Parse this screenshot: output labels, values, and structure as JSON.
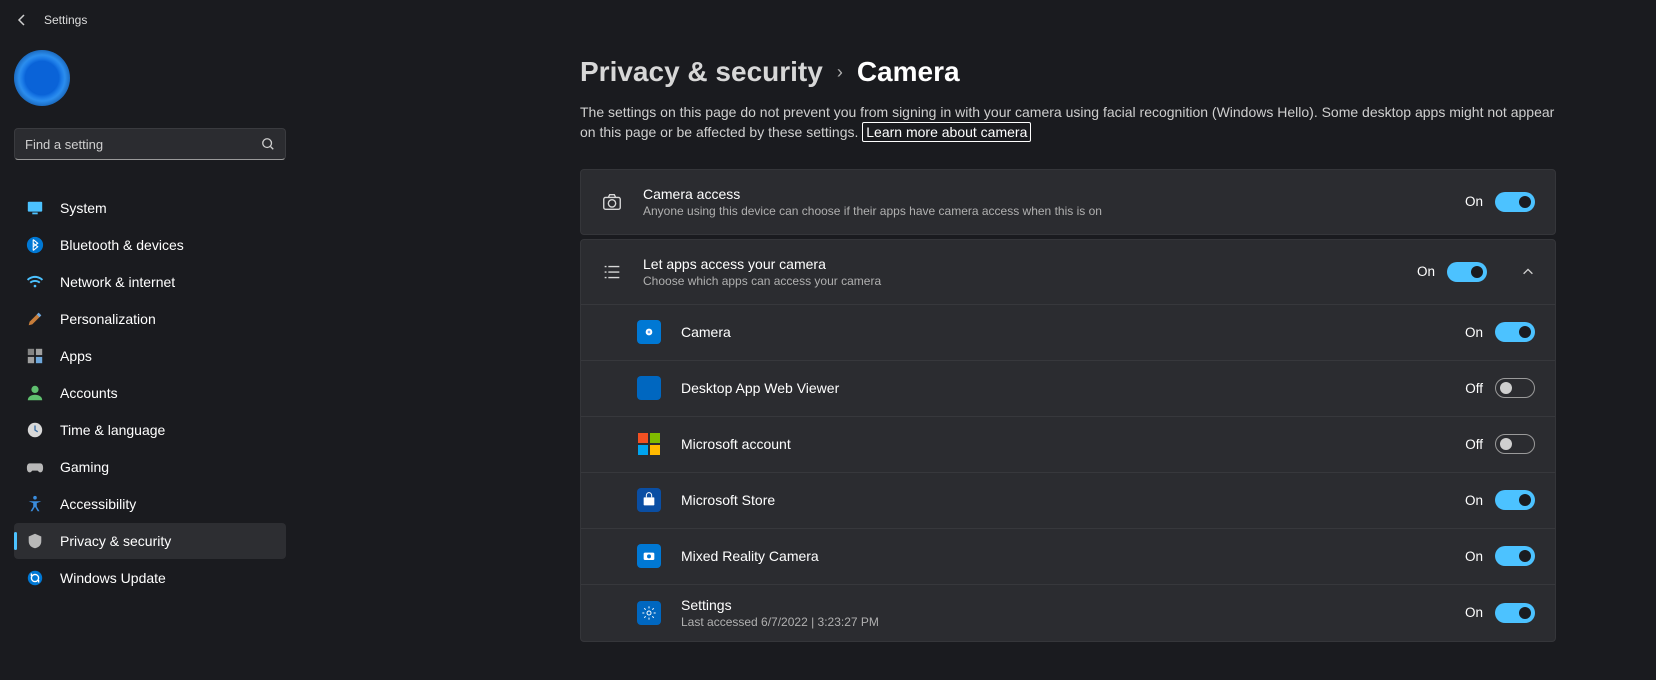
{
  "topbar": {
    "title": "Settings"
  },
  "search": {
    "placeholder": "Find a setting"
  },
  "nav": {
    "items": [
      {
        "label": "System"
      },
      {
        "label": "Bluetooth & devices"
      },
      {
        "label": "Network & internet"
      },
      {
        "label": "Personalization"
      },
      {
        "label": "Apps"
      },
      {
        "label": "Accounts"
      },
      {
        "label": "Time & language"
      },
      {
        "label": "Gaming"
      },
      {
        "label": "Accessibility"
      },
      {
        "label": "Privacy & security"
      },
      {
        "label": "Windows Update"
      }
    ]
  },
  "breadcrumb": {
    "parent": "Privacy & security",
    "current": "Camera"
  },
  "description": {
    "text": "The settings on this page do not prevent you from signing in with your camera using facial recognition (Windows Hello). Some desktop apps might not appear on this page or be affected by these settings. ",
    "link": "Learn more about camera"
  },
  "camera_access": {
    "title": "Camera access",
    "subtitle": "Anyone using this device can choose if their apps have camera access when this is on",
    "state": "On"
  },
  "let_apps": {
    "title": "Let apps access your camera",
    "subtitle": "Choose which apps can access your camera",
    "state": "On"
  },
  "apps": [
    {
      "name": "Camera",
      "state": "On",
      "icon": "camera",
      "sub": ""
    },
    {
      "name": "Desktop App Web Viewer",
      "state": "Off",
      "icon": "webview",
      "sub": ""
    },
    {
      "name": "Microsoft account",
      "state": "Off",
      "icon": "ms",
      "sub": ""
    },
    {
      "name": "Microsoft Store",
      "state": "On",
      "icon": "store",
      "sub": ""
    },
    {
      "name": "Mixed Reality Camera",
      "state": "On",
      "icon": "mixed",
      "sub": ""
    },
    {
      "name": "Settings",
      "state": "On",
      "icon": "settings",
      "sub": "Last accessed 6/7/2022  |  3:23:27 PM"
    }
  ],
  "toggle_labels": {
    "on": "On",
    "off": "Off"
  }
}
